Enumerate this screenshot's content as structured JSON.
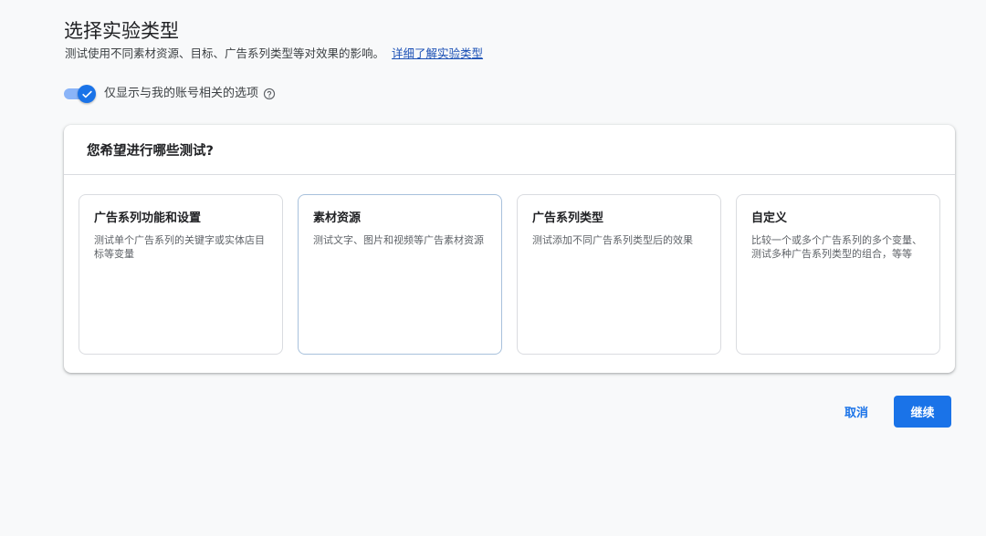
{
  "header": {
    "title": "选择实验类型",
    "subtitle": "测试使用不同素材资源、目标、广告系列类型等对效果的影响。",
    "learn_more": "详细了解实验类型"
  },
  "filter_toggle": {
    "label": "仅显示与我的账号相关的选项",
    "checked": true,
    "help_icon": "help-circle-icon"
  },
  "card": {
    "title": "您希望进行哪些测试?",
    "options": [
      {
        "title": "广告系列功能和设置",
        "description": "测试单个广告系列的关键字或实体店目标等变量"
      },
      {
        "title": "素材资源",
        "description": "测试文字、图片和视频等广告素材资源"
      },
      {
        "title": "广告系列类型",
        "description": "测试添加不同广告系列类型后的效果"
      },
      {
        "title": "自定义",
        "description": "比较一个或多个广告系列的多个变量、测试多种广告系列类型的组合，等等"
      }
    ]
  },
  "actions": {
    "cancel": "取消",
    "continue": "继续"
  },
  "colors": {
    "primary": "#1a73e8",
    "link": "#1a4fb5",
    "toggle_track": "#8ab4f8"
  }
}
